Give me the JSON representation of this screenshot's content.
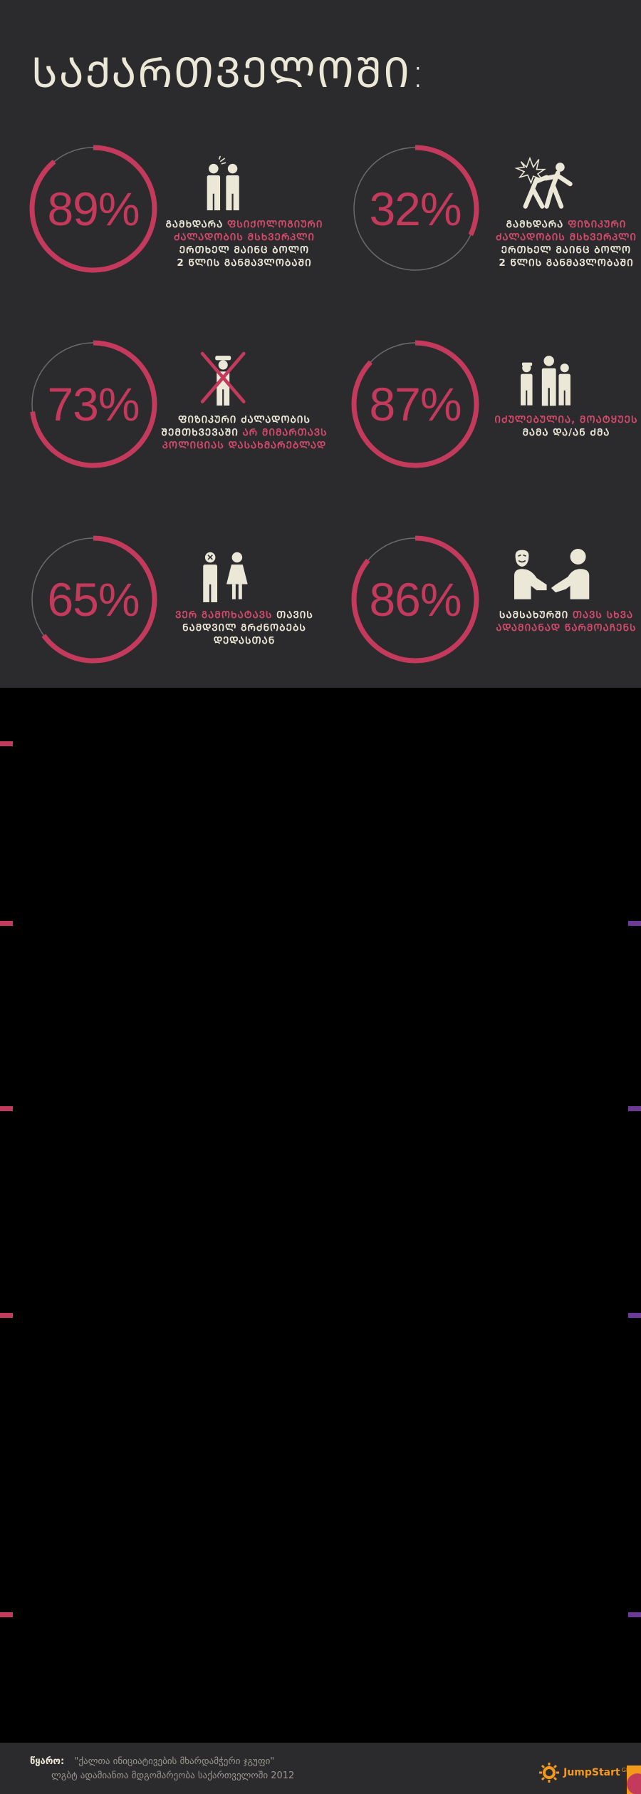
{
  "title": "ᲡᲐᲥᲐᲠᲗᲕᲔᲚᲝᲨᲘ:",
  "colors": {
    "accent": "#c43a5c",
    "cream": "#ece8d8",
    "background": "#2b2a2d",
    "track": "#6b6a6c"
  },
  "stats": [
    {
      "percent": 89,
      "label": "89%",
      "icon": "two-men-arguing-icon",
      "caption_lines": [
        [
          {
            "t": "ᲒᲐᲛᲮᲓᲐᲠᲐ "
          },
          {
            "t": "ᲤᲡᲘᲥᲝᲚᲝᲒᲘᲣᲠᲘ",
            "hl": true
          }
        ],
        [
          {
            "t": "ᲫᲐᲚᲐᲓᲝᲑᲘᲡ ᲛᲡᲮᲕᲔᲠᲞᲚᲘ",
            "hl": true
          }
        ],
        [
          {
            "t": "ᲔᲠᲗᲮᲔᲚ ᲛᲐᲘᲜᲪ ᲑᲝᲚᲝ"
          }
        ],
        [
          {
            "t": "2 ᲬᲚᲘᲡ ᲒᲐᲜᲛᲐᲕᲚᲝᲑᲐᲨᲘ"
          }
        ]
      ]
    },
    {
      "percent": 32,
      "label": "32%",
      "icon": "physical-violence-icon",
      "caption_lines": [
        [
          {
            "t": "ᲒᲐᲛᲮᲓᲐᲠᲐ "
          },
          {
            "t": "ᲤᲘᲖᲘᲙᲣᲠᲘ",
            "hl": true
          }
        ],
        [
          {
            "t": "ᲫᲐᲚᲐᲓᲝᲑᲘᲡ ᲛᲡᲮᲕᲔᲠᲞᲚᲘ",
            "hl": true
          }
        ],
        [
          {
            "t": "ᲔᲠᲗᲮᲔᲚ ᲛᲐᲘᲜᲪ ᲑᲝᲚᲝ"
          }
        ],
        [
          {
            "t": "2 ᲬᲚᲘᲡ ᲒᲐᲜᲛᲐᲕᲚᲝᲑᲐᲨᲘ"
          }
        ]
      ]
    },
    {
      "percent": 73,
      "label": "73%",
      "icon": "police-crossed-icon",
      "caption_lines": [
        [
          {
            "t": "ᲤᲘᲖᲘᲙᲣᲠᲘ ᲫᲐᲚᲐᲓᲝᲑᲘᲡ"
          }
        ],
        [
          {
            "t": "ᲨᲔᲛᲗᲮᲕᲔᲕᲐᲨᲘ "
          },
          {
            "t": "ᲐᲠ ᲛᲘᲛᲐᲠᲗᲐᲕᲡ",
            "hl": true
          }
        ],
        [
          {
            "t": "ᲞᲝᲚᲘᲪᲘᲐᲡ ᲓᲐᲡᲐᲮᲛᲐᲠᲔᲑᲚᲐᲓ",
            "hl": true
          }
        ]
      ]
    },
    {
      "percent": 87,
      "label": "87%",
      "icon": "family-men-icon",
      "caption_lines": [
        [
          {
            "t": "ᲘᲫᲣᲚᲔᲑᲣᲚᲘᲐ, ᲛᲝᲐᲢᲧᲣᲔᲡ",
            "hl": true
          }
        ],
        [
          {
            "t": "ᲛᲐᲛᲐ ᲓᲐ/ᲐᲜ ᲫᲛᲐ"
          }
        ]
      ]
    },
    {
      "percent": 65,
      "label": "65%",
      "icon": "man-woman-icon",
      "caption_lines": [
        [
          {
            "t": "ᲕᲔᲠ ᲒᲐᲛᲝᲮᲐᲢᲐᲕᲡ",
            "hl": true
          },
          {
            "t": " ᲗᲐᲕᲘᲡ"
          }
        ],
        [
          {
            "t": "ᲜᲐᲛᲓᲕᲘᲚ ᲒᲠᲫᲜᲝᲑᲔᲑᲡ"
          }
        ],
        [
          {
            "t": "ᲓᲔᲓᲐᲡᲗᲐᲜ"
          }
        ]
      ]
    },
    {
      "percent": 86,
      "label": "86%",
      "icon": "mask-handshake-icon",
      "caption_lines": [
        [
          {
            "t": "ᲡᲐᲛᲡᲐᲮᲣᲠᲨᲘ "
          },
          {
            "t": "ᲗᲐᲕᲡ ᲡᲮᲕᲐ",
            "hl": true
          }
        ],
        [
          {
            "t": "ᲐᲓᲐᲛᲘᲐᲜᲐᲓ ᲬᲐᲠᲛᲝᲐᲩᲔᲜᲡ",
            "hl": true
          }
        ]
      ]
    }
  ],
  "footer": {
    "source_label": "წყარო:",
    "source_line1": "\"ქალთა ინიციატივების მხარდამჭერი ჯგუფი\"",
    "source_line2": "ლგბტ ადამიანთა მდგომარეობა საქართველოში 2012"
  },
  "logo": {
    "text": "JumpStart",
    "suffix": "GE"
  }
}
